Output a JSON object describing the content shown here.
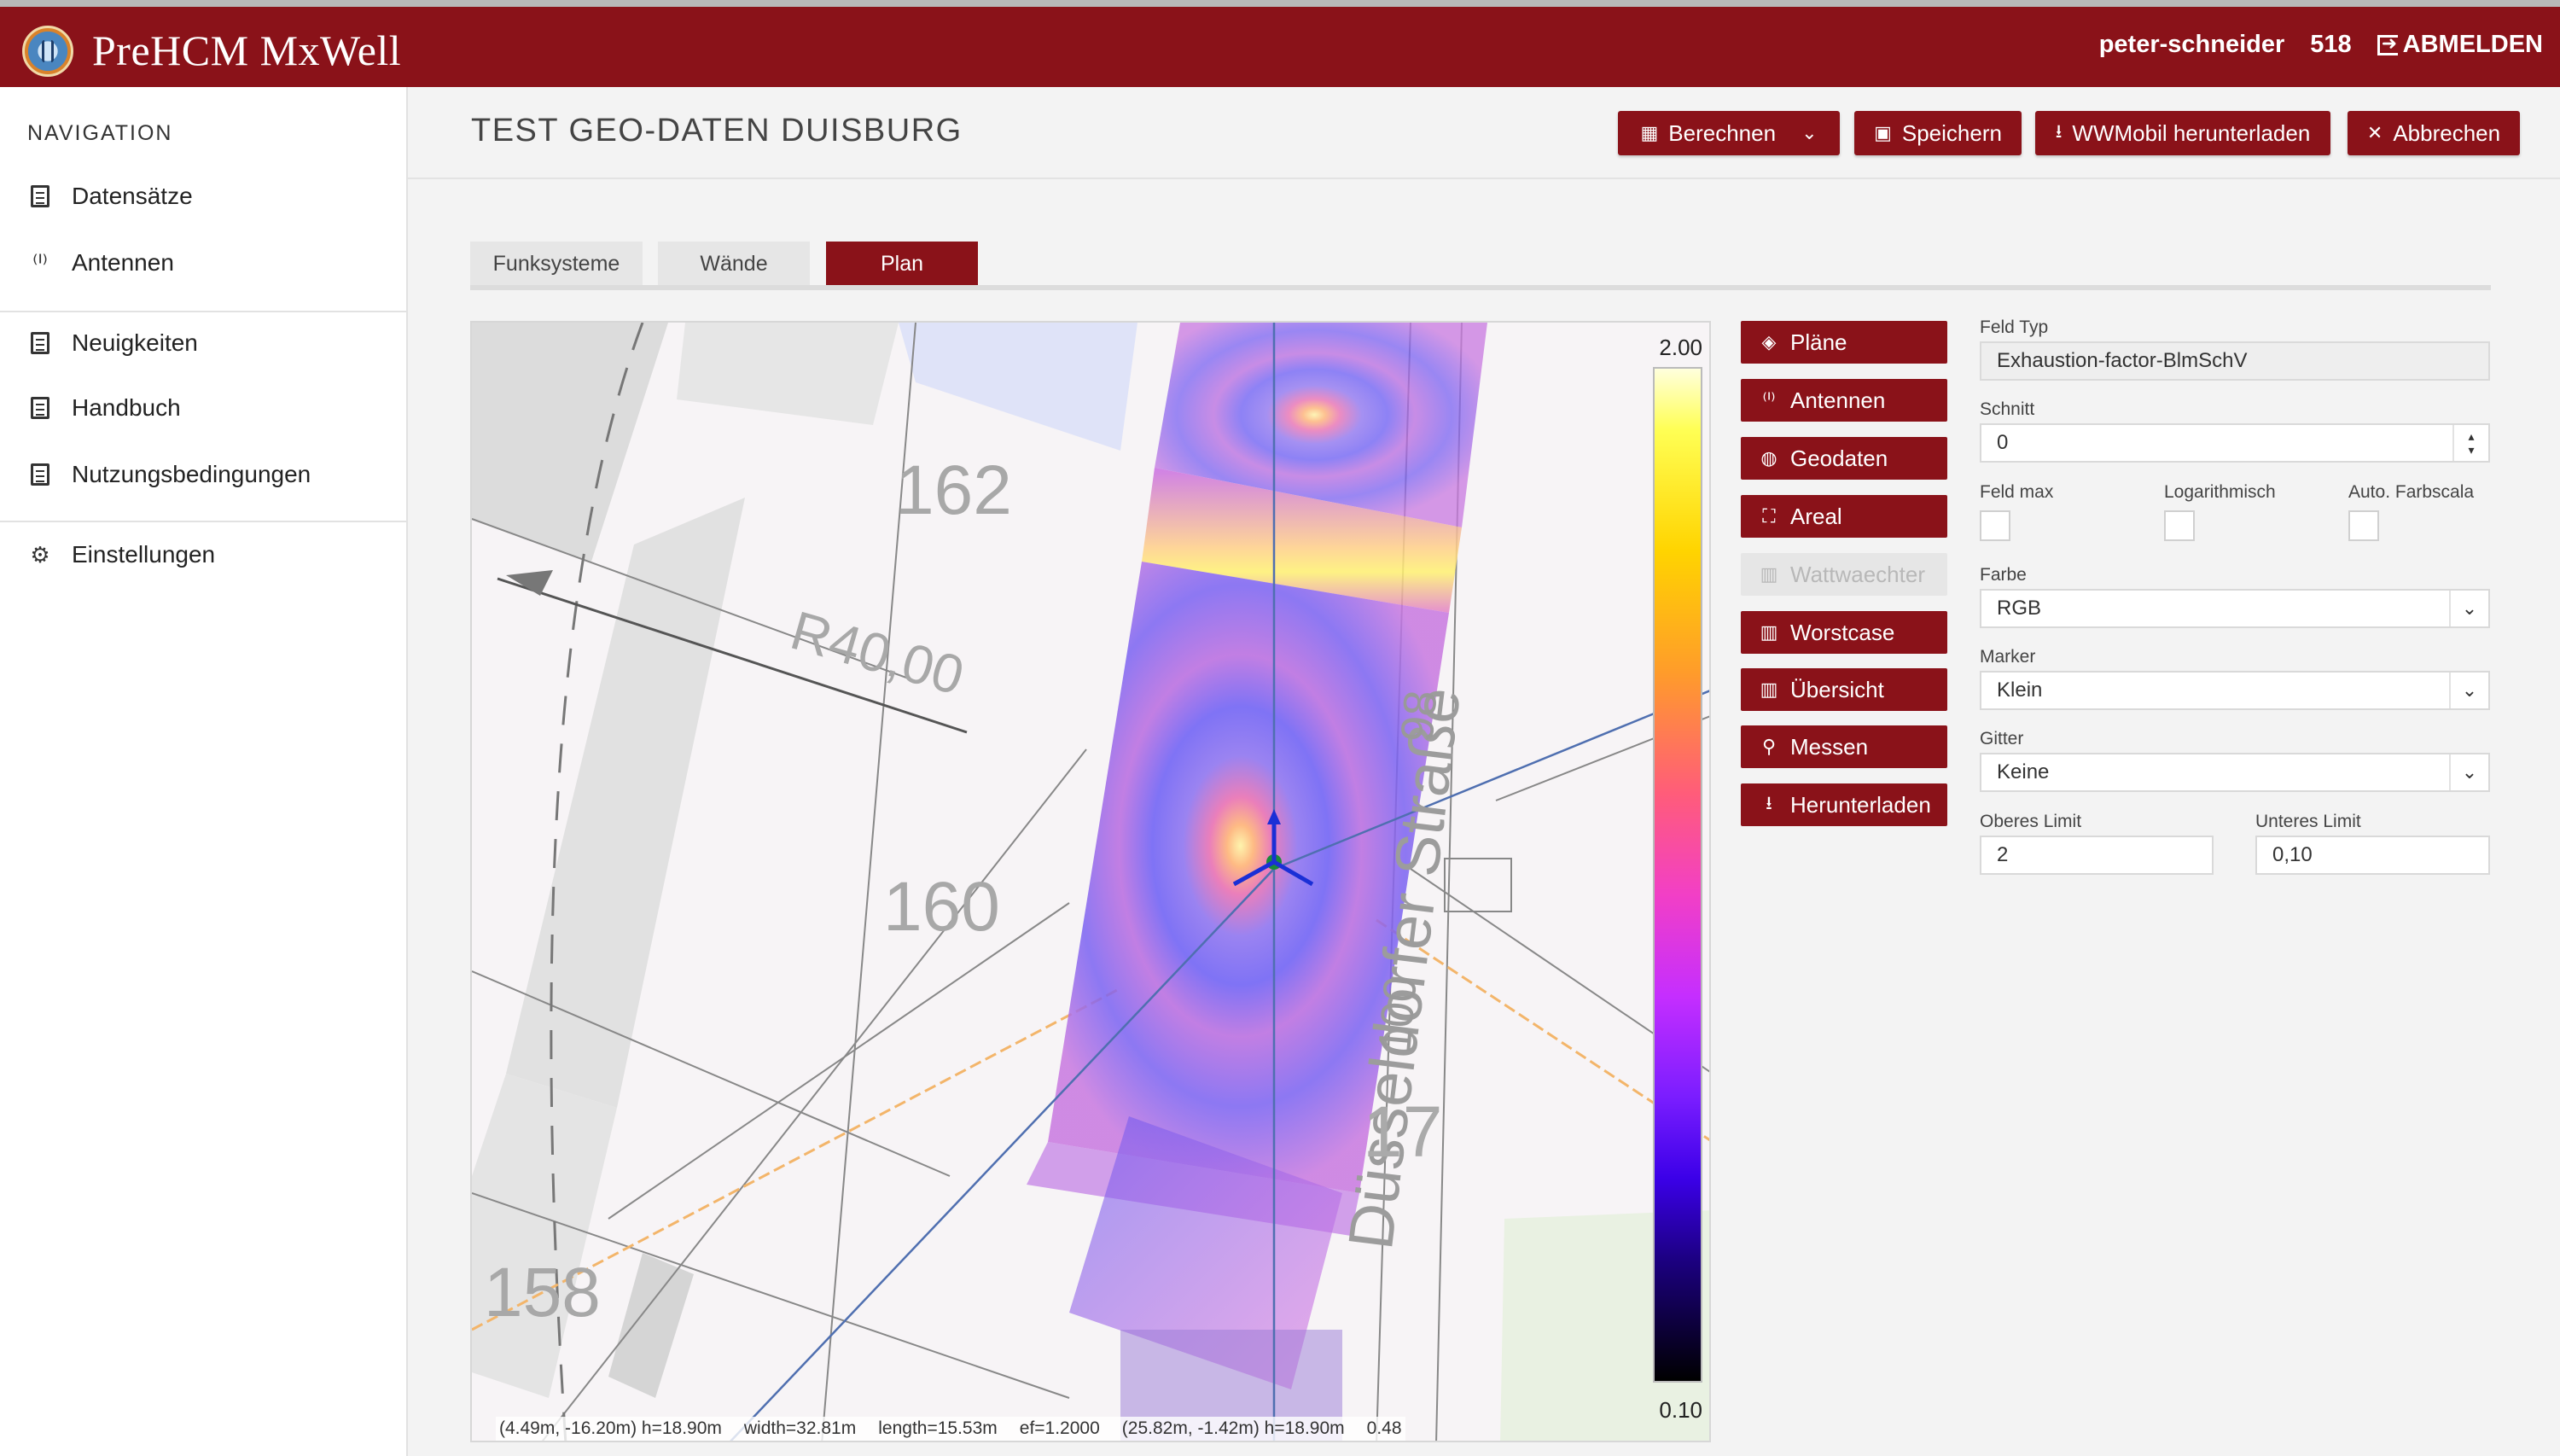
{
  "app": {
    "title": "PreHCM MxWell"
  },
  "user": {
    "name": "peter-schneider",
    "id": "518",
    "logout_label": "ABMELDEN"
  },
  "sidebar": {
    "heading": "NAVIGATION",
    "items": [
      {
        "label": "Datensätze",
        "icon": "list-icon"
      },
      {
        "label": "Antennen",
        "icon": "antenna-icon"
      },
      {
        "label": "Neuigkeiten",
        "icon": "news-icon"
      },
      {
        "label": "Handbuch",
        "icon": "manual-icon"
      },
      {
        "label": "Nutzungsbedingungen",
        "icon": "document-icon"
      },
      {
        "label": "Einstellungen",
        "icon": "gear-icon"
      }
    ]
  },
  "page": {
    "title": "TEST GEO-DATEN DUISBURG"
  },
  "toolbar": {
    "calculate_label": "Berechnen",
    "save_label": "Speichern",
    "download_label": "WWMobil herunterladen",
    "cancel_label": "Abbrechen"
  },
  "tabs": [
    {
      "label": "Funksysteme",
      "active": false
    },
    {
      "label": "Wände",
      "active": false
    },
    {
      "label": "Plan",
      "active": true
    }
  ],
  "map": {
    "scale_max": "2.00",
    "scale_min": "0.10",
    "cell_labels": [
      "162",
      "R40,00",
      "160",
      "158",
      "Düsseldorfer Straße",
      "98",
      "100",
      "17"
    ],
    "status": {
      "point1": "(4.49m, -16.20m) h=18.90m",
      "width": "width=32.81m",
      "length": "length=15.53m",
      "ef": "ef=1.2000",
      "point2": "(25.82m, -1.42m) h=18.90m",
      "value": "0.48"
    }
  },
  "actions": [
    {
      "label": "Pläne",
      "icon": "layers-icon",
      "enabled": true
    },
    {
      "label": "Antennen",
      "icon": "antenna-icon",
      "enabled": true
    },
    {
      "label": "Geodaten",
      "icon": "globe-icon",
      "enabled": true
    },
    {
      "label": "Areal",
      "icon": "area-icon",
      "enabled": true
    },
    {
      "label": "Wattwaechter",
      "icon": "chart-icon",
      "enabled": false
    },
    {
      "label": "Worstcase",
      "icon": "chart-icon",
      "enabled": true
    },
    {
      "label": "Übersicht",
      "icon": "chart-icon",
      "enabled": true
    },
    {
      "label": "Messen",
      "icon": "search-icon",
      "enabled": true
    },
    {
      "label": "Herunterladen",
      "icon": "download-icon",
      "enabled": true
    }
  ],
  "settings": {
    "field_type": {
      "label": "Feld Typ",
      "value": "Exhaustion-factor-BlmSchV"
    },
    "cut": {
      "label": "Schnitt",
      "value": "0"
    },
    "field_max": {
      "label": "Feld max"
    },
    "logarithmic": {
      "label": "Logarithmisch"
    },
    "auto_scale": {
      "label": "Auto. Farbscala"
    },
    "color": {
      "label": "Farbe",
      "value": "RGB"
    },
    "marker": {
      "label": "Marker",
      "value": "Klein"
    },
    "grid": {
      "label": "Gitter",
      "value": "Keine"
    },
    "upper_limit": {
      "label": "Oberes Limit",
      "value": "2"
    },
    "lower_limit": {
      "label": "Unteres Limit",
      "value": "0,10"
    }
  },
  "colors": {
    "brand": "#8a1219",
    "background": "#f3f3f3"
  }
}
